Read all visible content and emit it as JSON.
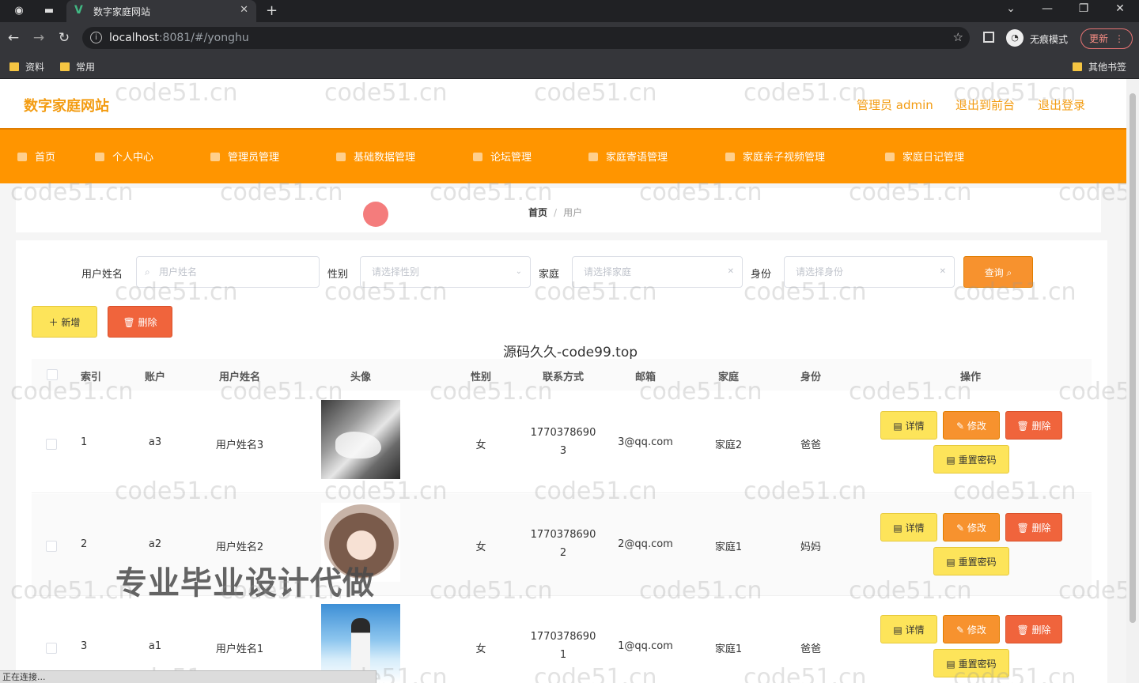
{
  "browser": {
    "tab_title": "数字家庭网站",
    "url_host": "localhost",
    "url_rest": ":8081/#/yonghu",
    "incognito_label": "无痕模式",
    "update_label": "更新",
    "bookmarks": [
      "资料",
      "常用"
    ],
    "other_bookmarks": "其他书签",
    "status_text": "正在连接..."
  },
  "header": {
    "brand": "数字家庭网站",
    "admin_label": "管理员 admin",
    "front_label": "退出到前台",
    "logout_label": "退出登录"
  },
  "nav": {
    "items": [
      "首页",
      "个人中心",
      "管理员管理",
      "基础数据管理",
      "论坛管理",
      "家庭寄语管理",
      "家庭亲子视频管理",
      "家庭日记管理"
    ]
  },
  "breadcrumb": {
    "home": "首页",
    "current": "用户"
  },
  "filters": {
    "name_label": "用户姓名",
    "name_placeholder": "用户姓名",
    "gender_label": "性别",
    "gender_placeholder": "请选择性别",
    "family_label": "家庭",
    "family_placeholder": "请选择家庭",
    "role_label": "身份",
    "role_placeholder": "请选择身份",
    "query_label": "查询"
  },
  "actions": {
    "add_label": "新增",
    "delete_label": "删除"
  },
  "table": {
    "headers": [
      "索引",
      "账户",
      "用户姓名",
      "头像",
      "性别",
      "联系方式",
      "邮箱",
      "家庭",
      "身份",
      "操作"
    ],
    "row_buttons": {
      "detail": "详情",
      "edit": "修改",
      "delete": "删除",
      "reset": "重置密码"
    },
    "rows": [
      {
        "index": "1",
        "account": "a3",
        "name": "用户姓名3",
        "gender": "女",
        "phone1": "1770378690",
        "phone2": "3",
        "email": "3@qq.com",
        "family": "家庭2",
        "role": "爸爸",
        "avatar": "wolf"
      },
      {
        "index": "2",
        "account": "a2",
        "name": "用户姓名2",
        "gender": "女",
        "phone1": "1770378690",
        "phone2": "2",
        "email": "2@qq.com",
        "family": "家庭1",
        "role": "妈妈",
        "avatar": "girl"
      },
      {
        "index": "3",
        "account": "a1",
        "name": "用户姓名1",
        "gender": "女",
        "phone1": "1770378690",
        "phone2": "1",
        "email": "1@qq.com",
        "family": "家庭1",
        "role": "爸爸",
        "avatar": "boy"
      }
    ]
  },
  "overlay": {
    "center_watermark": "源码久久-code99.top",
    "promo_text": "专业毕业设计代做",
    "tile_watermark": "code51.cn"
  },
  "colors": {
    "accent": "#ff9500",
    "brand_text": "#f39c12",
    "danger": "#f0643c",
    "warning": "#fde45a"
  }
}
